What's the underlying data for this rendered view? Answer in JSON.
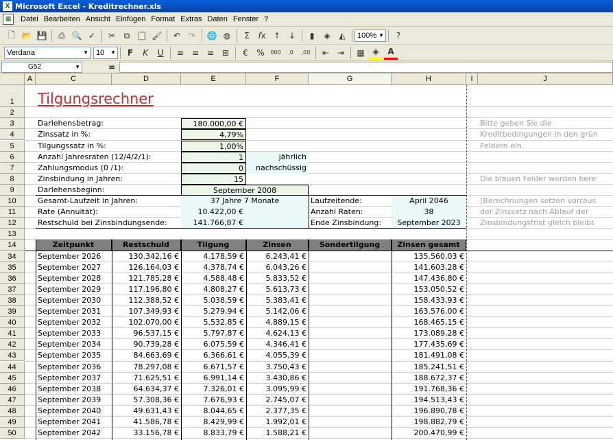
{
  "window": {
    "title": "Microsoft Excel - Kreditrechner.xls",
    "app_icon": "X"
  },
  "menu": [
    "Datei",
    "Bearbeiten",
    "Ansicht",
    "Einfügen",
    "Format",
    "Extras",
    "Daten",
    "Fenster",
    "?"
  ],
  "toolbar": {
    "zoom": "100%",
    "font_name": "Verdana",
    "font_size": "10"
  },
  "formula_bar": {
    "name_box": "G52",
    "eq_sign": "=",
    "content": ""
  },
  "columns": [
    "A",
    "C",
    "D",
    "E",
    "F",
    "G",
    "H",
    "I",
    "J"
  ],
  "sheet": {
    "title": "Tilgungsrechner",
    "inputs": [
      {
        "label": "Darlehensbetrag:",
        "value": "180.000,00 €",
        "extra": ""
      },
      {
        "label": "Zinssatz in %:",
        "value": "4,79%",
        "extra": ""
      },
      {
        "label": "Tilgungssatz in %:",
        "value": "1,00%",
        "extra": ""
      },
      {
        "label": "Anzahl Jahresraten (12/4/2/1):",
        "value": "1",
        "extra": "jährlich"
      },
      {
        "label": "Zahlungsmodus (0 /1):",
        "value": "0",
        "extra": "nachschüssig"
      },
      {
        "label": "Zinsbindung in Jahren:",
        "value": "15",
        "extra": ""
      },
      {
        "label": "Darlehensbeginn:",
        "value": "September 2008",
        "extra": ""
      }
    ],
    "results_left": [
      {
        "label": "Gesamt-Laufzeit in Jahren:",
        "value": "37 Jahre 7 Monate"
      },
      {
        "label": "Rate (Annuität):",
        "value": "10.422,00 €"
      },
      {
        "label": "Restschuld bei Zinsbindungsende:",
        "value": "141.766,87 €"
      }
    ],
    "results_right": [
      {
        "label": "Laufzeitende:",
        "value": "April 2046"
      },
      {
        "label": "Anzahl Raten:",
        "value": "38"
      },
      {
        "label": "Ende Zinsbindung:",
        "value": "September 2023"
      }
    ],
    "notes": [
      "Bitte geben Sie die",
      "Kreditbedingungen in den grün",
      "Feldern ein.",
      "Die blauen Felder werden bere",
      "(Berechnungen setzen vorraus",
      "der Zinssatz nach Ablauf der",
      "Zinsbindungsfrist gleich bleibt"
    ],
    "table_headers": [
      "Zeitpunkt",
      "Restschuld",
      "Tilgung",
      "Zinsen",
      "Sondertilgung",
      "Zinsen gesamt"
    ],
    "row_numbers_top": [
      "1",
      "2",
      "3",
      "4",
      "5",
      "6",
      "7",
      "8",
      "9",
      "10",
      "11",
      "12",
      "13",
      "14"
    ],
    "rows": [
      {
        "n": "34",
        "date": "September 2026",
        "rest": "130.342,16 €",
        "tilg": "4.178,59 €",
        "zins": "6.243,41 €",
        "sonder": "",
        "gesamt": "135.560,03 €"
      },
      {
        "n": "35",
        "date": "September 2027",
        "rest": "126.164,03 €",
        "tilg": "4.378,74 €",
        "zins": "6.043,26 €",
        "sonder": "",
        "gesamt": "141.603,28 €"
      },
      {
        "n": "36",
        "date": "September 2028",
        "rest": "121.785,28 €",
        "tilg": "4.588,48 €",
        "zins": "5.833,52 €",
        "sonder": "",
        "gesamt": "147.436,80 €"
      },
      {
        "n": "37",
        "date": "September 2029",
        "rest": "117.196,80 €",
        "tilg": "4.808,27 €",
        "zins": "5.613,73 €",
        "sonder": "",
        "gesamt": "153.050,52 €"
      },
      {
        "n": "38",
        "date": "September 2030",
        "rest": "112.388,52 €",
        "tilg": "5.038,59 €",
        "zins": "5.383,41 €",
        "sonder": "",
        "gesamt": "158.433,93 €"
      },
      {
        "n": "39",
        "date": "September 2031",
        "rest": "107.349,93 €",
        "tilg": "5.279,94 €",
        "zins": "5.142,06 €",
        "sonder": "",
        "gesamt": "163.576,00 €"
      },
      {
        "n": "40",
        "date": "September 2032",
        "rest": "102.070,00 €",
        "tilg": "5.532,85 €",
        "zins": "4.889,15 €",
        "sonder": "",
        "gesamt": "168.465,15 €"
      },
      {
        "n": "41",
        "date": "September 2033",
        "rest": "96.537,15 €",
        "tilg": "5.797,87 €",
        "zins": "4.624,13 €",
        "sonder": "",
        "gesamt": "173.089,28 €"
      },
      {
        "n": "42",
        "date": "September 2034",
        "rest": "90.739,28 €",
        "tilg": "6.075,59 €",
        "zins": "4.346,41 €",
        "sonder": "",
        "gesamt": "177.435,69 €"
      },
      {
        "n": "43",
        "date": "September 2035",
        "rest": "84.663,69 €",
        "tilg": "6.366,61 €",
        "zins": "4.055,39 €",
        "sonder": "",
        "gesamt": "181.491,08 €"
      },
      {
        "n": "44",
        "date": "September 2036",
        "rest": "78.297,08 €",
        "tilg": "6.671,57 €",
        "zins": "3.750,43 €",
        "sonder": "",
        "gesamt": "185.241,51 €"
      },
      {
        "n": "45",
        "date": "September 2037",
        "rest": "71.625,51 €",
        "tilg": "6.991,14 €",
        "zins": "3.430,86 €",
        "sonder": "",
        "gesamt": "188.672,37 €"
      },
      {
        "n": "46",
        "date": "September 2038",
        "rest": "64.634,37 €",
        "tilg": "7.326,01 €",
        "zins": "3.095,99 €",
        "sonder": "",
        "gesamt": "191.768,36 €"
      },
      {
        "n": "47",
        "date": "September 2039",
        "rest": "57.308,36 €",
        "tilg": "7.676,93 €",
        "zins": "2.745,07 €",
        "sonder": "",
        "gesamt": "194.513,43 €"
      },
      {
        "n": "48",
        "date": "September 2040",
        "rest": "49.631,43 €",
        "tilg": "8.044,65 €",
        "zins": "2.377,35 €",
        "sonder": "",
        "gesamt": "196.890,78 €"
      },
      {
        "n": "49",
        "date": "September 2041",
        "rest": "41.586,78 €",
        "tilg": "8.429,99 €",
        "zins": "1.992,01 €",
        "sonder": "",
        "gesamt": "198.882,79 €"
      },
      {
        "n": "50",
        "date": "September 2042",
        "rest": "33.156,78 €",
        "tilg": "8.833,79 €",
        "zins": "1.588,21 €",
        "sonder": "",
        "gesamt": "200.470,99 €"
      }
    ]
  },
  "colors": {
    "title_red": "#c0302a",
    "input_green": "#ebf5e8",
    "calc_blue": "#e8f7f8",
    "header_gray": "#808080"
  }
}
